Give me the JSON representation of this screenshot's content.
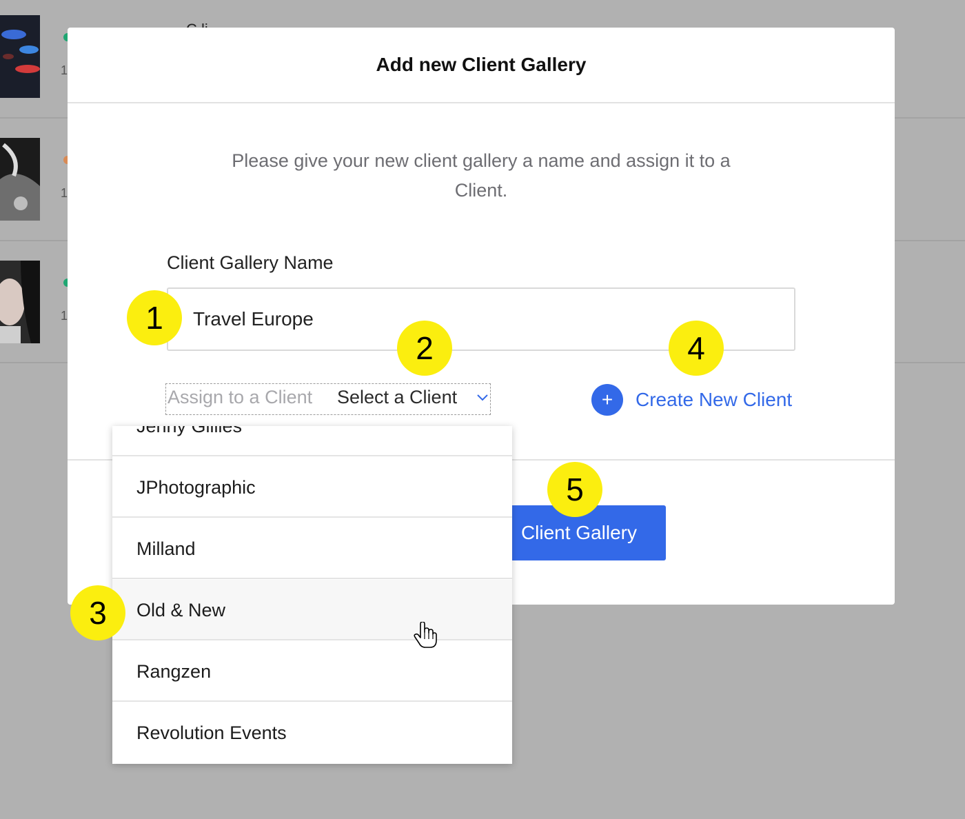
{
  "background": {
    "partial_text": "C  li",
    "rows": [
      {
        "dot_color": "#1fa672",
        "num": "1"
      },
      {
        "dot_color": "#d88a55",
        "num": "1"
      },
      {
        "dot_color": "#1fa672",
        "num": "1"
      }
    ]
  },
  "modal": {
    "title": "Add new Client Gallery",
    "description": "Please give your new client gallery a name and assign it to a Client.",
    "name_label": "Client Gallery Name",
    "name_value": "Travel Europe",
    "assign_label": "Assign to a Client",
    "assign_value": "Select a Client",
    "create_client_label": "Create New Client",
    "create_client_icon": "plus-icon",
    "primary_button_label": "Client Gallery"
  },
  "dropdown": {
    "items": [
      "Jenny Gillies",
      "JPhotographic",
      "Milland",
      "Old & New",
      "Rangzen",
      "Revolution Events"
    ],
    "hovered": "Old & New"
  },
  "callouts": [
    "1",
    "2",
    "3",
    "4",
    "5"
  ],
  "colors": {
    "accent": "#3369e8",
    "callout": "#fbee0f",
    "overlay": "#b1b1b1"
  }
}
